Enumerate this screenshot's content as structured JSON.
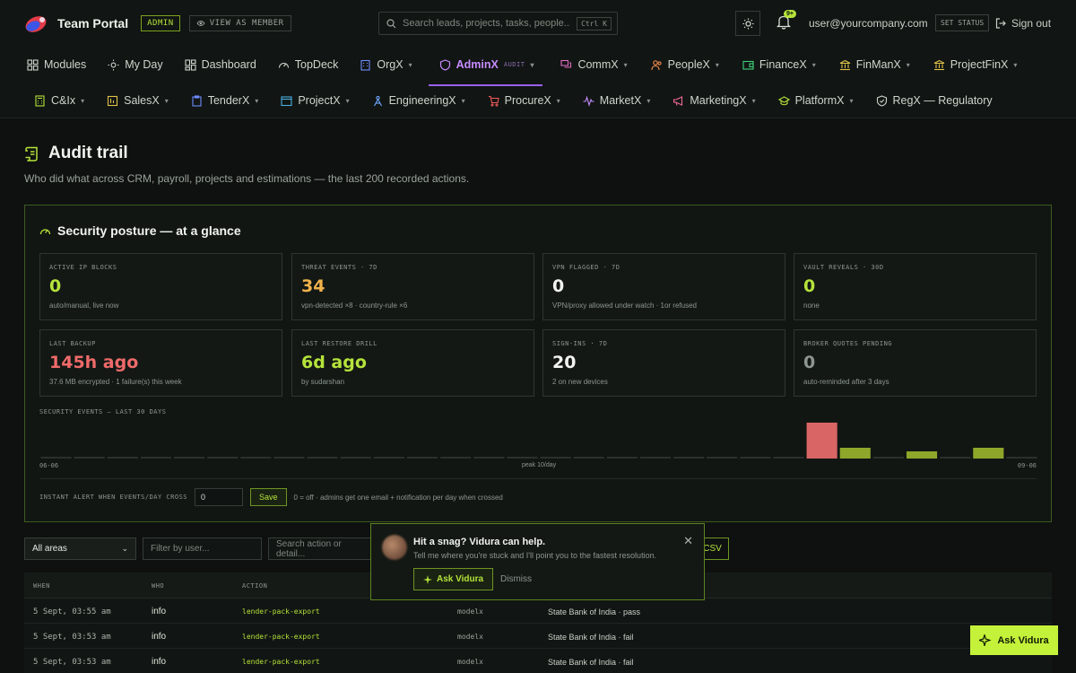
{
  "header": {
    "brand": "Team Portal",
    "admin_badge": "ADMIN",
    "view_as_member": "VIEW AS MEMBER",
    "search_placeholder": "Search leads, projects, tasks, people...",
    "search_shortcut": "Ctrl K",
    "notifications_badge": "9+",
    "user_email": "user@yourcompany.com",
    "set_status": "SET STATUS",
    "sign_out": "Sign out"
  },
  "nav_row1": [
    {
      "label": "Modules",
      "icon": "grid-icon",
      "chevron": false
    },
    {
      "label": "My Day",
      "icon": "sun-icon",
      "chevron": false
    },
    {
      "label": "Dashboard",
      "icon": "dashboard-icon",
      "chevron": false
    },
    {
      "label": "TopDeck",
      "icon": "gauge-icon",
      "chevron": false
    },
    {
      "label": "OrgX",
      "icon": "building-icon",
      "chevron": true
    },
    {
      "label": "AdminX",
      "sub": "AUDIT",
      "icon": "shield-icon",
      "chevron": true,
      "active": true
    },
    {
      "label": "CommX",
      "icon": "chat-icon",
      "chevron": true
    },
    {
      "label": "PeopleX",
      "icon": "people-icon",
      "chevron": true
    },
    {
      "label": "FinanceX",
      "icon": "wallet-icon",
      "chevron": true
    },
    {
      "label": "FinManX",
      "icon": "bank-icon",
      "chevron": true
    },
    {
      "label": "ProjectFinX",
      "icon": "bank-icon",
      "chevron": true
    }
  ],
  "nav_row2": [
    {
      "label": "C&Ix",
      "icon": "calculator-icon",
      "chevron": true
    },
    {
      "label": "SalesX",
      "icon": "sales-icon",
      "chevron": true
    },
    {
      "label": "TenderX",
      "icon": "tender-icon",
      "chevron": true
    },
    {
      "label": "ProjectX",
      "icon": "project-icon",
      "chevron": true
    },
    {
      "label": "EngineeringX",
      "icon": "engineering-icon",
      "chevron": true
    },
    {
      "label": "ProcureX",
      "icon": "cart-icon",
      "chevron": true
    },
    {
      "label": "MarketX",
      "icon": "pulse-icon",
      "chevron": true
    },
    {
      "label": "MarketingX",
      "icon": "megaphone-icon",
      "chevron": true
    },
    {
      "label": "PlatformX",
      "icon": "platform-icon",
      "chevron": true
    },
    {
      "label": "RegX — Regulatory",
      "icon": "shield-check-icon",
      "chevron": false
    }
  ],
  "page": {
    "title": "Audit trail",
    "subtitle": "Who did what across CRM, payroll, projects and estimations — the last 200 recorded actions."
  },
  "posture": {
    "title": "Security posture — at a glance",
    "cards": [
      {
        "label": "ACTIVE IP BLOCKS",
        "value": "0",
        "note": "auto/manual, live now",
        "color": "#b5e33a"
      },
      {
        "label": "THREAT EVENTS · 7D",
        "value": "34",
        "note": "vpn-detected ×8 · country-rule ×6",
        "color": "#f0b24a"
      },
      {
        "label": "VPN FLAGGED · 7D",
        "value": "0",
        "note": "VPN/proxy allowed under watch · 1or refused",
        "color": "#f1f4ee"
      },
      {
        "label": "VAULT REVEALS · 30D",
        "value": "0",
        "note": "none",
        "color": "#b5e33a"
      },
      {
        "label": "LAST BACKUP",
        "value": "145h ago",
        "note": "37.6 MB encrypted · 1 failure(s) this week",
        "color": "#ef6a6a"
      },
      {
        "label": "LAST RESTORE DRILL",
        "value": "6d ago",
        "note": "by sudarshan",
        "color": "#b5e33a"
      },
      {
        "label": "SIGN-INS · 7D",
        "value": "20",
        "note": "2 on new devices",
        "color": "#f1f4ee"
      },
      {
        "label": "BROKER QUOTES PENDING",
        "value": "0",
        "note": "auto-reminded after 3 days",
        "color": "#8d968e"
      }
    ],
    "chart_label": "SECURITY EVENTS — LAST 30 DAYS",
    "axis_start": "06-06",
    "axis_peak": "peak 10/day",
    "axis_end": "09-06",
    "alert_label": "INSTANT ALERT WHEN EVENTS/DAY CROSS",
    "alert_value": "0",
    "save_label": "Save",
    "alert_help": "0 = off · admins get one email + notification per day when crossed"
  },
  "chart_data": {
    "type": "bar",
    "title": "SECURITY EVENTS — LAST 30 DAYS",
    "x_start": "06-06",
    "x_end": "09-06",
    "values": [
      0,
      0,
      0,
      0,
      0,
      0,
      0,
      0,
      0,
      0,
      0,
      0,
      0,
      0,
      0,
      0,
      0,
      0,
      0,
      0,
      0,
      0,
      0,
      10,
      3,
      0,
      2,
      0,
      3,
      0
    ],
    "colors": {
      "peak": "#d96565",
      "normal": "#8ea62a",
      "empty": "#2a302c"
    },
    "ylim": [
      0,
      10
    ]
  },
  "filters": {
    "area_selected": "All areas",
    "user_placeholder": "Filter by user...",
    "action_placeholder": "Search action or detail...",
    "csv_label": "CSV"
  },
  "table": {
    "headers": {
      "when": "WHEN",
      "who": "WHO",
      "action": "ACTION"
    },
    "rows": [
      {
        "when": "5 Sept, 03:55 am",
        "who": "info",
        "action": "lender-pack-export",
        "area": "modelx",
        "detail": "State Bank of India · pass"
      },
      {
        "when": "5 Sept, 03:53 am",
        "who": "info",
        "action": "lender-pack-export",
        "area": "modelx",
        "detail": "State Bank of India · fail"
      },
      {
        "when": "5 Sept, 03:53 am",
        "who": "info",
        "action": "lender-pack-export",
        "area": "modelx",
        "detail": "State Bank of India · fail"
      }
    ]
  },
  "snag": {
    "title": "Hit a snag? Vidura can help.",
    "message": "Tell me where you're stuck and I'll point you to the fastest resolution.",
    "ask_label": "Ask Vidura",
    "dismiss_label": "Dismiss"
  },
  "ask_button": "Ask Vidura"
}
